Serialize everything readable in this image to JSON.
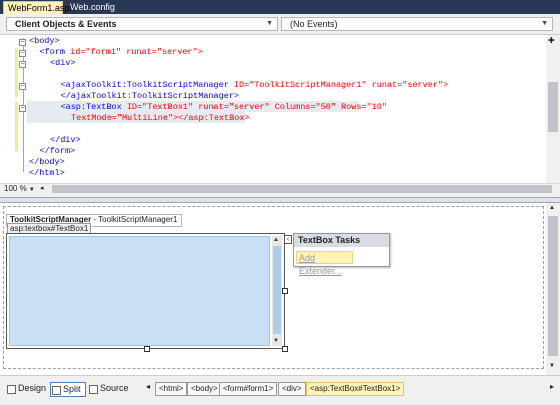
{
  "tabs": [
    {
      "label": "WebForm1.aspx*",
      "active": true
    },
    {
      "label": "Web.config",
      "active": false
    }
  ],
  "navbar": {
    "objects_combo": "Client Objects & Events",
    "events_combo": "(No Events)"
  },
  "code": {
    "lines": [
      {
        "indent": 0,
        "tag": "<body>"
      },
      {
        "indent": 1,
        "tag": "<form",
        "attrs": " id=\"form1\" runat=\"server\">"
      },
      {
        "indent": 2,
        "tag": "<div>"
      },
      {
        "indent": 0,
        "tag": ""
      },
      {
        "indent": 3,
        "tag": "<ajaxToolkit:ToolkitScriptManager",
        "attrs": " ID=\"ToolkitScriptManager1\" runat=\"server\">"
      },
      {
        "indent": 3,
        "tag": "</ajaxToolkit:ToolkitScriptManager>"
      },
      {
        "indent": 3,
        "tag": "<asp:TextBox",
        "attrs": " ID=\"TextBox1\" runat=\"server\" Columns=\"50\" Rows=\"10\""
      },
      {
        "indent": 4,
        "tag": "",
        "attrs": "TextMode=\"MultiLine\"></asp:TextBox>"
      },
      {
        "indent": 0,
        "tag": ""
      },
      {
        "indent": 2,
        "tag": "</div>"
      },
      {
        "indent": 1,
        "tag": "</form>"
      },
      {
        "indent": 0,
        "tag": "</body>"
      },
      {
        "indent": 0,
        "tag": "</html>"
      }
    ]
  },
  "editor": {
    "zoom": "100 %"
  },
  "design": {
    "script_manager_label_bold": "ToolkitScriptManager",
    "script_manager_label_rest": " - ToolkitScriptManager1",
    "textbox_tag": "asp:textbox#TextBox1",
    "smart_tag_arrow": "‹",
    "tasks_title": "TextBox Tasks",
    "tasks_link": "Add Extender..."
  },
  "views": {
    "design": "Design",
    "split": "Split",
    "source": "Source"
  },
  "breadcrumb": [
    "<html>",
    "<body>",
    "<form#form1>",
    "<div>",
    "<asp:TextBox#TextBox1>"
  ],
  "colors": {
    "tabstrip": "#293955",
    "active_tab": "#fff3b8",
    "textbox_fill": "#c9dff5"
  }
}
